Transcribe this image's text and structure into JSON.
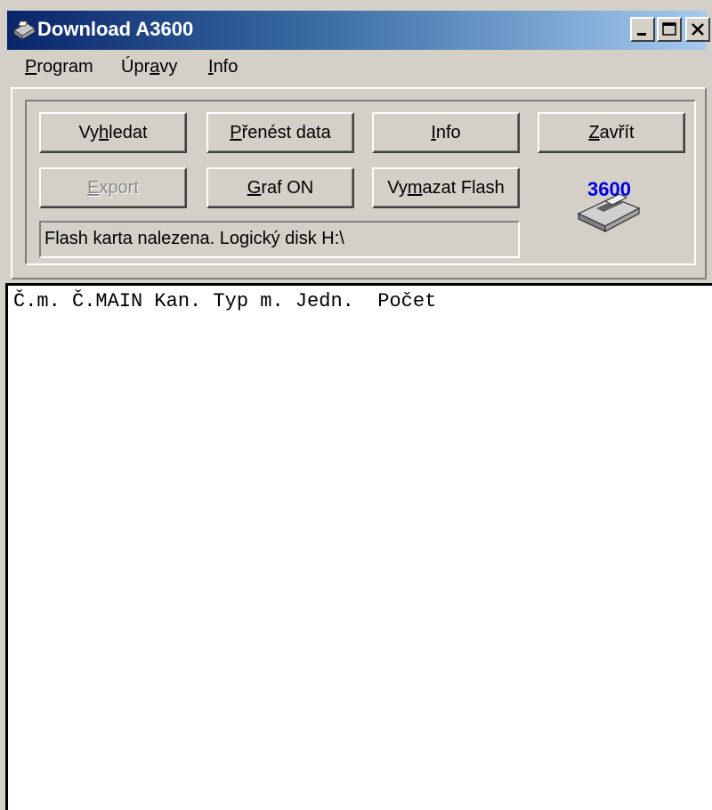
{
  "window": {
    "title": "Download A3600",
    "icon": "printer-icon"
  },
  "menu": [
    {
      "label": "Program",
      "accel_index": 0
    },
    {
      "label": "Úpravy",
      "accel_index": 3
    },
    {
      "label": "Info",
      "accel_index": 0
    }
  ],
  "buttons": {
    "vyhledat": "Vyhledat",
    "prenest": "Přenést data",
    "info": "Info",
    "zavrit": "Zavřít",
    "export": "Export",
    "graf": "Graf ON",
    "vymazat": "Vymazat Flash"
  },
  "status": "Flash karta nalezena. Logický disk H:\\",
  "device": {
    "label": "3600",
    "icon": "device-printer-icon",
    "label_color": "#0000e6"
  },
  "output": {
    "header": "Č.m. Č.MAIN Kan. Typ m. Jedn.  Počet"
  },
  "colors": {
    "titlebar_start": "#0a246a",
    "titlebar_end": "#a6caf0",
    "face": "#d4d0c8",
    "disabled_text": "#8a8a8a"
  }
}
